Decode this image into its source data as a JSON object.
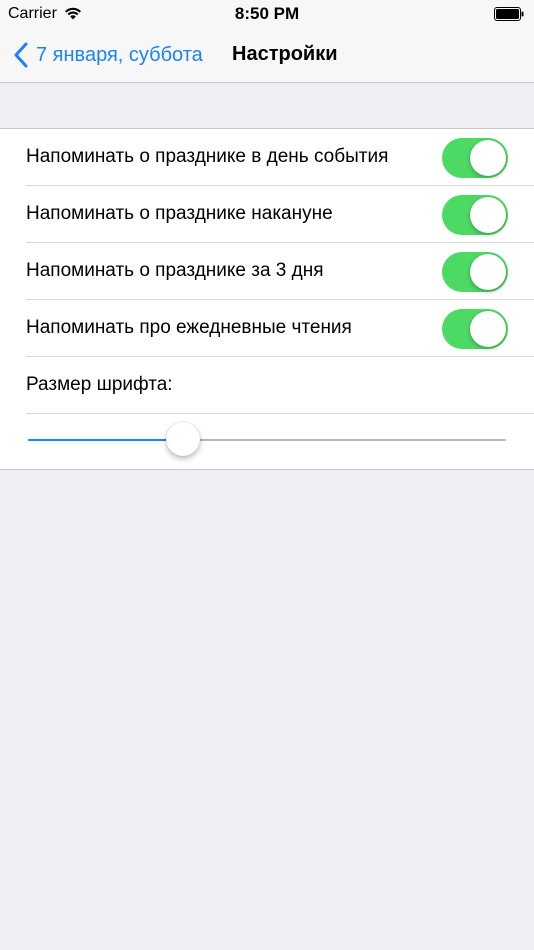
{
  "status_bar": {
    "carrier": "Carrier",
    "time": "8:50 PM",
    "wifi_icon": "wifi-icon",
    "battery_icon": "battery-icon"
  },
  "nav": {
    "back_label": "7 января, суббота",
    "back_icon": "chevron-left-icon",
    "title": "Настройки"
  },
  "settings": {
    "toggles": [
      {
        "label": "Напоминать о празднике в день события",
        "on": true
      },
      {
        "label": "Напоминать о празднике накануне",
        "on": true
      },
      {
        "label": "Напоминать о празднике за 3 дня",
        "on": true
      },
      {
        "label": "Напоминать про ежедневные чтения",
        "on": true
      }
    ],
    "font_size_label": "Размер шрифта:",
    "font_size_slider": 0.31
  },
  "colors": {
    "accent": "#1a82fb",
    "switch_on": "#4cd964",
    "background": "#efeff4"
  }
}
